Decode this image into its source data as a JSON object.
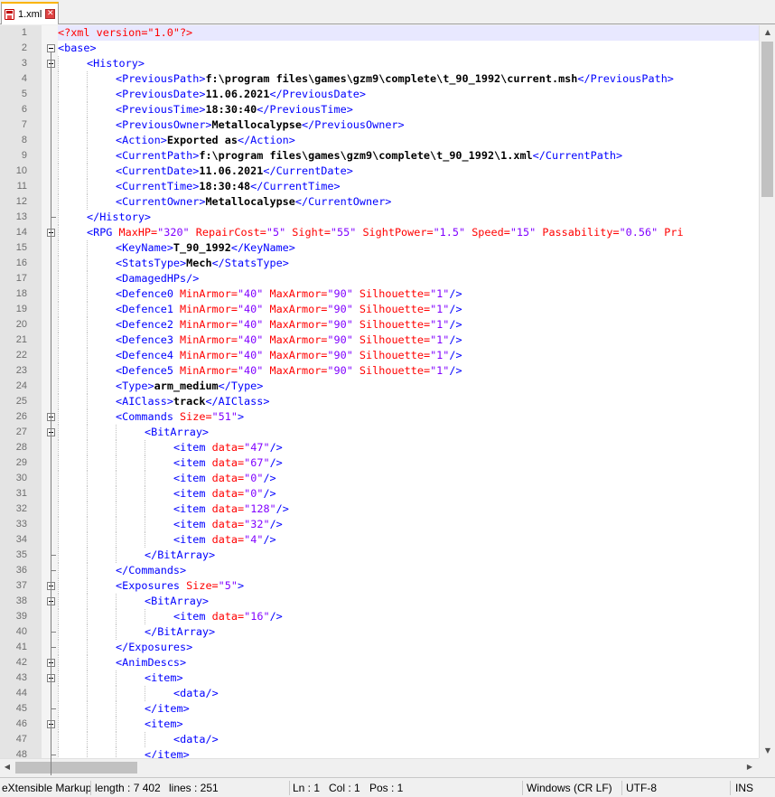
{
  "tab": {
    "label": "1.xml"
  },
  "statusbar": {
    "language": "eXtensible Markup",
    "length": "length : 7 402",
    "lines": "lines : 251",
    "ln": "Ln : 1",
    "col": "Col : 1",
    "pos": "Pos : 1",
    "eol": "Windows (CR LF)",
    "encoding": "UTF-8",
    "mode": "INS"
  },
  "lines": [
    {
      "n": "1",
      "indent": 0,
      "t": [
        [
          "decl",
          "<?xml version=\"1.0\"?>"
        ]
      ]
    },
    {
      "n": "2",
      "indent": 0,
      "t": [
        [
          "tag",
          "<base>"
        ]
      ]
    },
    {
      "n": "3",
      "indent": 1,
      "t": [
        [
          "tag",
          "<History>"
        ]
      ]
    },
    {
      "n": "4",
      "indent": 2,
      "t": [
        [
          "tag",
          "<PreviousPath>"
        ],
        [
          "text",
          "f:\\program files\\games\\gzm9\\complete\\t_90_1992\\current.msh"
        ],
        [
          "tag",
          "</PreviousPath>"
        ]
      ]
    },
    {
      "n": "5",
      "indent": 2,
      "t": [
        [
          "tag",
          "<PreviousDate>"
        ],
        [
          "text",
          "11.06.2021"
        ],
        [
          "tag",
          "</PreviousDate>"
        ]
      ]
    },
    {
      "n": "6",
      "indent": 2,
      "t": [
        [
          "tag",
          "<PreviousTime>"
        ],
        [
          "text",
          "18:30:40"
        ],
        [
          "tag",
          "</PreviousTime>"
        ]
      ]
    },
    {
      "n": "7",
      "indent": 2,
      "t": [
        [
          "tag",
          "<PreviousOwner>"
        ],
        [
          "text",
          "Metallocalypse"
        ],
        [
          "tag",
          "</PreviousOwner>"
        ]
      ]
    },
    {
      "n": "8",
      "indent": 2,
      "t": [
        [
          "tag",
          "<Action>"
        ],
        [
          "text",
          "Exported as"
        ],
        [
          "tag",
          "</Action>"
        ]
      ]
    },
    {
      "n": "9",
      "indent": 2,
      "t": [
        [
          "tag",
          "<CurrentPath>"
        ],
        [
          "text",
          "f:\\program files\\games\\gzm9\\complete\\t_90_1992\\1.xml"
        ],
        [
          "tag",
          "</CurrentPath>"
        ]
      ]
    },
    {
      "n": "10",
      "indent": 2,
      "t": [
        [
          "tag",
          "<CurrentDate>"
        ],
        [
          "text",
          "11.06.2021"
        ],
        [
          "tag",
          "</CurrentDate>"
        ]
      ]
    },
    {
      "n": "11",
      "indent": 2,
      "t": [
        [
          "tag",
          "<CurrentTime>"
        ],
        [
          "text",
          "18:30:48"
        ],
        [
          "tag",
          "</CurrentTime>"
        ]
      ]
    },
    {
      "n": "12",
      "indent": 2,
      "t": [
        [
          "tag",
          "<CurrentOwner>"
        ],
        [
          "text",
          "Metallocalypse"
        ],
        [
          "tag",
          "</CurrentOwner>"
        ]
      ]
    },
    {
      "n": "13",
      "indent": 1,
      "t": [
        [
          "tag",
          "</History>"
        ]
      ]
    },
    {
      "n": "14",
      "indent": 1,
      "t": [
        [
          "tag",
          "<RPG "
        ],
        [
          "attr",
          "MaxHP="
        ],
        [
          "val",
          "\"320\""
        ],
        [
          "attr",
          " RepairCost="
        ],
        [
          "val",
          "\"5\""
        ],
        [
          "attr",
          " Sight="
        ],
        [
          "val",
          "\"55\""
        ],
        [
          "attr",
          " SightPower="
        ],
        [
          "val",
          "\"1.5\""
        ],
        [
          "attr",
          " Speed="
        ],
        [
          "val",
          "\"15\""
        ],
        [
          "attr",
          " Passability="
        ],
        [
          "val",
          "\"0.56\""
        ],
        [
          "attr",
          " Pri"
        ]
      ]
    },
    {
      "n": "15",
      "indent": 2,
      "t": [
        [
          "tag",
          "<KeyName>"
        ],
        [
          "text",
          "T_90_1992"
        ],
        [
          "tag",
          "</KeyName>"
        ]
      ]
    },
    {
      "n": "16",
      "indent": 2,
      "t": [
        [
          "tag",
          "<StatsType>"
        ],
        [
          "text",
          "Mech"
        ],
        [
          "tag",
          "</StatsType>"
        ]
      ]
    },
    {
      "n": "17",
      "indent": 2,
      "t": [
        [
          "tag",
          "<DamagedHPs/>"
        ]
      ]
    },
    {
      "n": "18",
      "indent": 2,
      "t": [
        [
          "tag",
          "<Defence0 "
        ],
        [
          "attr",
          "MinArmor="
        ],
        [
          "val",
          "\"40\""
        ],
        [
          "attr",
          " MaxArmor="
        ],
        [
          "val",
          "\"90\""
        ],
        [
          "attr",
          " Silhouette="
        ],
        [
          "val",
          "\"1\""
        ],
        [
          "tag",
          "/>"
        ]
      ]
    },
    {
      "n": "19",
      "indent": 2,
      "t": [
        [
          "tag",
          "<Defence1 "
        ],
        [
          "attr",
          "MinArmor="
        ],
        [
          "val",
          "\"40\""
        ],
        [
          "attr",
          " MaxArmor="
        ],
        [
          "val",
          "\"90\""
        ],
        [
          "attr",
          " Silhouette="
        ],
        [
          "val",
          "\"1\""
        ],
        [
          "tag",
          "/>"
        ]
      ]
    },
    {
      "n": "20",
      "indent": 2,
      "t": [
        [
          "tag",
          "<Defence2 "
        ],
        [
          "attr",
          "MinArmor="
        ],
        [
          "val",
          "\"40\""
        ],
        [
          "attr",
          " MaxArmor="
        ],
        [
          "val",
          "\"90\""
        ],
        [
          "attr",
          " Silhouette="
        ],
        [
          "val",
          "\"1\""
        ],
        [
          "tag",
          "/>"
        ]
      ]
    },
    {
      "n": "21",
      "indent": 2,
      "t": [
        [
          "tag",
          "<Defence3 "
        ],
        [
          "attr",
          "MinArmor="
        ],
        [
          "val",
          "\"40\""
        ],
        [
          "attr",
          " MaxArmor="
        ],
        [
          "val",
          "\"90\""
        ],
        [
          "attr",
          " Silhouette="
        ],
        [
          "val",
          "\"1\""
        ],
        [
          "tag",
          "/>"
        ]
      ]
    },
    {
      "n": "22",
      "indent": 2,
      "t": [
        [
          "tag",
          "<Defence4 "
        ],
        [
          "attr",
          "MinArmor="
        ],
        [
          "val",
          "\"40\""
        ],
        [
          "attr",
          " MaxArmor="
        ],
        [
          "val",
          "\"90\""
        ],
        [
          "attr",
          " Silhouette="
        ],
        [
          "val",
          "\"1\""
        ],
        [
          "tag",
          "/>"
        ]
      ]
    },
    {
      "n": "23",
      "indent": 2,
      "t": [
        [
          "tag",
          "<Defence5 "
        ],
        [
          "attr",
          "MinArmor="
        ],
        [
          "val",
          "\"40\""
        ],
        [
          "attr",
          " MaxArmor="
        ],
        [
          "val",
          "\"90\""
        ],
        [
          "attr",
          " Silhouette="
        ],
        [
          "val",
          "\"1\""
        ],
        [
          "tag",
          "/>"
        ]
      ]
    },
    {
      "n": "24",
      "indent": 2,
      "t": [
        [
          "tag",
          "<Type>"
        ],
        [
          "text",
          "arm_medium"
        ],
        [
          "tag",
          "</Type>"
        ]
      ]
    },
    {
      "n": "25",
      "indent": 2,
      "t": [
        [
          "tag",
          "<AIClass>"
        ],
        [
          "text",
          "track"
        ],
        [
          "tag",
          "</AIClass>"
        ]
      ]
    },
    {
      "n": "26",
      "indent": 2,
      "t": [
        [
          "tag",
          "<Commands "
        ],
        [
          "attr",
          "Size="
        ],
        [
          "val",
          "\"51\""
        ],
        [
          "tag",
          ">"
        ]
      ]
    },
    {
      "n": "27",
      "indent": 3,
      "t": [
        [
          "tag",
          "<BitArray>"
        ]
      ]
    },
    {
      "n": "28",
      "indent": 4,
      "t": [
        [
          "tag",
          "<item "
        ],
        [
          "attr",
          "data="
        ],
        [
          "val",
          "\"47\""
        ],
        [
          "tag",
          "/>"
        ]
      ]
    },
    {
      "n": "29",
      "indent": 4,
      "t": [
        [
          "tag",
          "<item "
        ],
        [
          "attr",
          "data="
        ],
        [
          "val",
          "\"67\""
        ],
        [
          "tag",
          "/>"
        ]
      ]
    },
    {
      "n": "30",
      "indent": 4,
      "t": [
        [
          "tag",
          "<item "
        ],
        [
          "attr",
          "data="
        ],
        [
          "val",
          "\"0\""
        ],
        [
          "tag",
          "/>"
        ]
      ]
    },
    {
      "n": "31",
      "indent": 4,
      "t": [
        [
          "tag",
          "<item "
        ],
        [
          "attr",
          "data="
        ],
        [
          "val",
          "\"0\""
        ],
        [
          "tag",
          "/>"
        ]
      ]
    },
    {
      "n": "32",
      "indent": 4,
      "t": [
        [
          "tag",
          "<item "
        ],
        [
          "attr",
          "data="
        ],
        [
          "val",
          "\"128\""
        ],
        [
          "tag",
          "/>"
        ]
      ]
    },
    {
      "n": "33",
      "indent": 4,
      "t": [
        [
          "tag",
          "<item "
        ],
        [
          "attr",
          "data="
        ],
        [
          "val",
          "\"32\""
        ],
        [
          "tag",
          "/>"
        ]
      ]
    },
    {
      "n": "34",
      "indent": 4,
      "t": [
        [
          "tag",
          "<item "
        ],
        [
          "attr",
          "data="
        ],
        [
          "val",
          "\"4\""
        ],
        [
          "tag",
          "/>"
        ]
      ]
    },
    {
      "n": "35",
      "indent": 3,
      "t": [
        [
          "tag",
          "</BitArray>"
        ]
      ]
    },
    {
      "n": "36",
      "indent": 2,
      "t": [
        [
          "tag",
          "</Commands>"
        ]
      ]
    },
    {
      "n": "37",
      "indent": 2,
      "t": [
        [
          "tag",
          "<Exposures "
        ],
        [
          "attr",
          "Size="
        ],
        [
          "val",
          "\"5\""
        ],
        [
          "tag",
          ">"
        ]
      ]
    },
    {
      "n": "38",
      "indent": 3,
      "t": [
        [
          "tag",
          "<BitArray>"
        ]
      ]
    },
    {
      "n": "39",
      "indent": 4,
      "t": [
        [
          "tag",
          "<item "
        ],
        [
          "attr",
          "data="
        ],
        [
          "val",
          "\"16\""
        ],
        [
          "tag",
          "/>"
        ]
      ]
    },
    {
      "n": "40",
      "indent": 3,
      "t": [
        [
          "tag",
          "</BitArray>"
        ]
      ]
    },
    {
      "n": "41",
      "indent": 2,
      "t": [
        [
          "tag",
          "</Exposures>"
        ]
      ]
    },
    {
      "n": "42",
      "indent": 2,
      "t": [
        [
          "tag",
          "<AnimDescs>"
        ]
      ]
    },
    {
      "n": "43",
      "indent": 3,
      "t": [
        [
          "tag",
          "<item>"
        ]
      ]
    },
    {
      "n": "44",
      "indent": 4,
      "t": [
        [
          "tag",
          "<data/>"
        ]
      ]
    },
    {
      "n": "45",
      "indent": 3,
      "t": [
        [
          "tag",
          "</item>"
        ]
      ]
    },
    {
      "n": "46",
      "indent": 3,
      "t": [
        [
          "tag",
          "<item>"
        ]
      ]
    },
    {
      "n": "47",
      "indent": 4,
      "t": [
        [
          "tag",
          "<data/>"
        ]
      ]
    },
    {
      "n": "48",
      "indent": 3,
      "t": [
        [
          "tag",
          "</item>"
        ]
      ]
    }
  ]
}
